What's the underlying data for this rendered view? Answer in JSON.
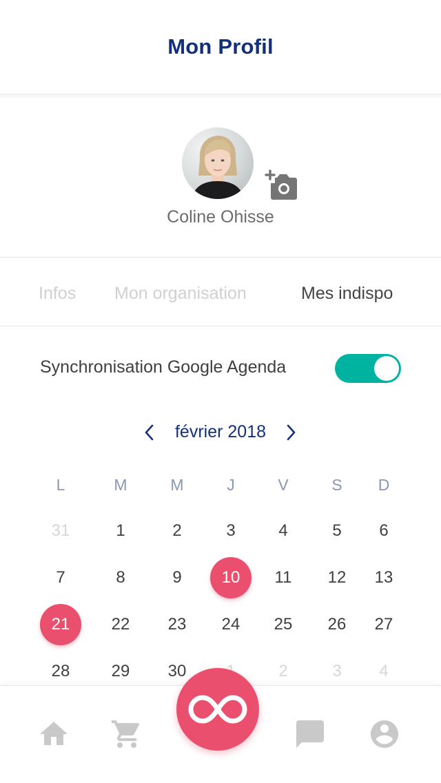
{
  "header": {
    "title": "Mon Profil"
  },
  "profile": {
    "name": "Coline Ohisse",
    "camera_icon": "add-photo-icon"
  },
  "tabs": [
    {
      "label": "Infos",
      "active": false
    },
    {
      "label": "Mon organisation",
      "active": false
    },
    {
      "label": "Mes indispo",
      "active": true
    }
  ],
  "sync": {
    "label": "Synchronisation Google Agenda",
    "enabled": true
  },
  "calendar": {
    "month_label": "février 2018",
    "weekdays": [
      "L",
      "M",
      "M",
      "J",
      "V",
      "S",
      "D"
    ],
    "weeks": [
      [
        "31",
        "1",
        "2",
        "3",
        "4",
        "5",
        "6"
      ],
      [
        "7",
        "8",
        "9",
        "10",
        "11",
        "12",
        "13"
      ],
      [
        "21",
        "22",
        "23",
        "24",
        "25",
        "26",
        "27"
      ],
      [
        "28",
        "29",
        "30",
        "1",
        "2",
        "3",
        "4"
      ]
    ],
    "selected_days": [
      "10",
      "21"
    ]
  },
  "bottom_nav": {
    "items": [
      "home-icon",
      "cart-icon",
      "app-logo-icon",
      "chat-icon",
      "account-icon"
    ]
  },
  "colors": {
    "primary": "#13307a",
    "accent": "#ea4f6e",
    "toggle_on": "#00b3a0",
    "inactive_icon": "#c9c9c9"
  }
}
